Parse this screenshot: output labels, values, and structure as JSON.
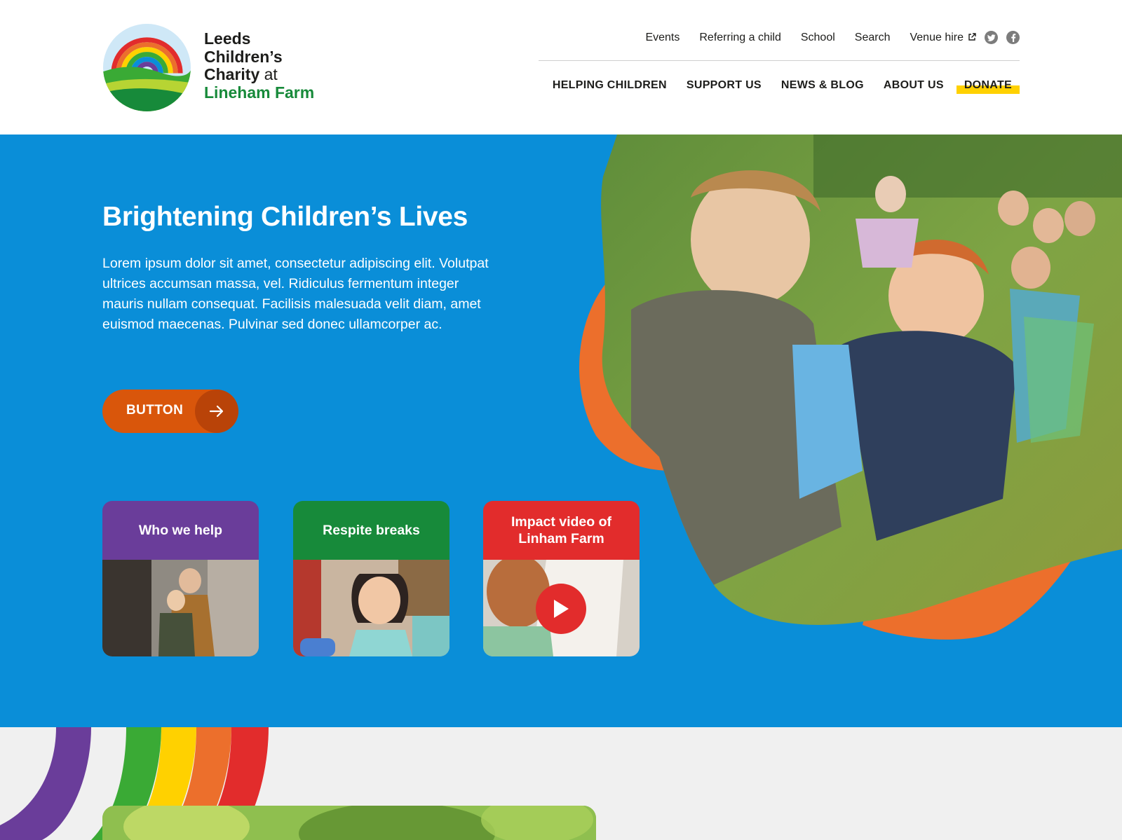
{
  "brand": {
    "name_lines": [
      "Leeds",
      "Children’s",
      "Charity",
      "at",
      "Lineham Farm"
    ]
  },
  "top_nav": {
    "links": [
      "Events",
      "Referring a child",
      "School",
      "Search",
      "Venue hire"
    ],
    "social_icons": [
      "twitter-icon",
      "facebook-icon"
    ]
  },
  "main_nav": {
    "links": [
      "HELPING CHILDREN",
      "SUPPORT US",
      "NEWS & BLOG",
      "ABOUT US"
    ],
    "donate": "DONATE"
  },
  "hero": {
    "title": "Brightening Children’s Lives",
    "body": "Lorem ipsum dolor sit amet, consectetur adipiscing elit. Volutpat ultrices accumsan massa, vel. Ridiculus fermentum integer mauris nullam consequat. Facilisis malesuada velit diam, amet euismod maecenas. Pulvinar sed donec ullamcorper ac.",
    "button_label": "BUTTON"
  },
  "cards": [
    {
      "title": "Who we help"
    },
    {
      "title": "Respite breaks"
    },
    {
      "title": "Impact video of Linham Farm"
    }
  ],
  "colors": {
    "hero_blue": "#0a8ed8",
    "accent_orange": "#ec6f2c",
    "button_orange": "#d9560b",
    "purple": "#6a3d9a",
    "green": "#178a3a",
    "red": "#e22c2c",
    "donate_yellow": "#ffd100"
  }
}
